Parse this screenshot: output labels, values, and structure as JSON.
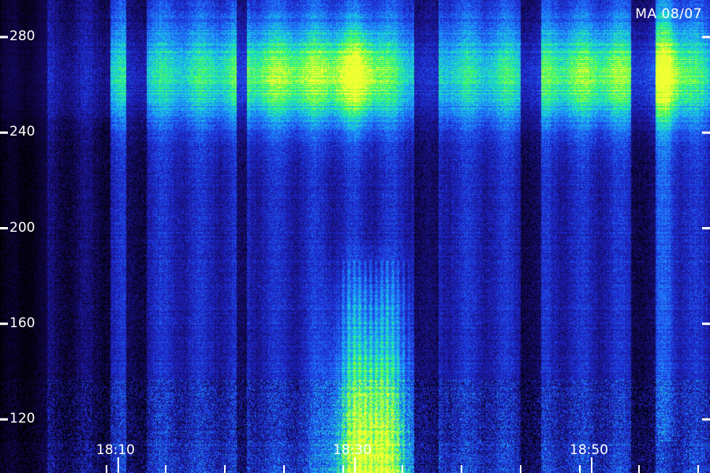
{
  "chart_data": {
    "type": "heatmap",
    "title": "MA 08/07",
    "xlabel": "",
    "ylabel": "",
    "y_ticks": [
      "280",
      "240",
      "200",
      "160",
      "120"
    ],
    "y_tick_values": [
      280,
      240,
      200,
      160,
      120
    ],
    "x_ticks": [
      "18:10",
      "18:30",
      "18:50"
    ],
    "x_range": [
      "18:09",
      "18:51"
    ],
    "y_range": [
      110,
      290
    ],
    "colormap": [
      "#000000",
      "#1a0a6e",
      "#1f2fd8",
      "#1e90ff",
      "#18e0d0",
      "#40ff40",
      "#f0ff30"
    ],
    "features": [
      {
        "name": "strong band",
        "y_range": [
          240,
          290
        ]
      },
      {
        "name": "burst",
        "time": "18:30",
        "y_range": [
          110,
          180
        ]
      }
    ]
  }
}
